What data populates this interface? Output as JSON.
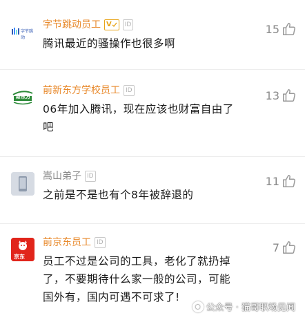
{
  "comments": [
    {
      "author": "字节跳动员工",
      "verified_badge": "V",
      "id_badge": "ID",
      "avatar_text": "字节跳动",
      "text": "腾讯最近的骚操作也很多啊",
      "likes": "15"
    },
    {
      "author": "前新东方学校员工",
      "id_badge": "ID",
      "avatar_text": "新东方",
      "text_lines": [
        "06年加入腾讯，现在应该也财富自由了",
        "吧"
      ],
      "likes": "13"
    },
    {
      "author": "嵩山弟子",
      "id_badge": "ID",
      "text": "之前是不是也有个8年被辞退的",
      "likes": "11"
    },
    {
      "author": "前京东员工",
      "id_badge": "ID",
      "avatar_text": "京东",
      "text_lines": [
        "员工不过是公司的工具，老化了就扔掉",
        "了，不要期待什么家一般的公司，可能",
        "国外有，国内可遇不可求了!"
      ],
      "likes": "7"
    }
  ],
  "watermark": {
    "text": "公众号 · 猫哥职场见闻"
  },
  "colors": {
    "author_orange": "#e8892b",
    "author_gray": "#8a8a8a",
    "body_text": "#1a1a1a",
    "like_gray": "#8a8a8a"
  }
}
